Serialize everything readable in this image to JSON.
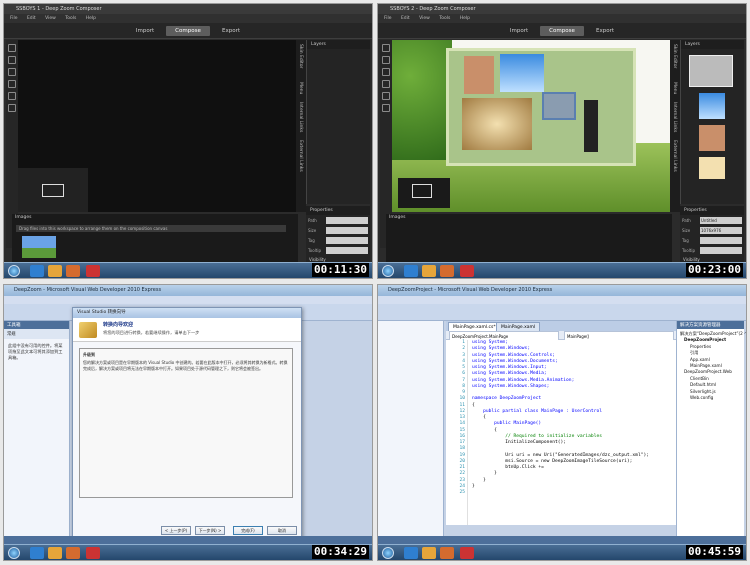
{
  "panels": [
    {
      "title": "SSBOYS 1 - Deep Zoom Composer",
      "menu": [
        "File",
        "Edit",
        "View",
        "Tools",
        "Help"
      ],
      "tabs": [
        "Import",
        "Compose",
        "Export"
      ],
      "active_tab": "Compose",
      "side_tabs": [
        "Skin Editor",
        "Menu",
        "Internal Links",
        "External Links"
      ],
      "layers_title": "Layers",
      "properties_title": "Properties",
      "properties": [
        {
          "label": "Path",
          "value": ""
        },
        {
          "label": "Size",
          "value": ""
        },
        {
          "label": "Tag",
          "value": ""
        },
        {
          "label": "Tooltip",
          "value": ""
        }
      ],
      "visibility_label": "Visibility",
      "images_title": "Images",
      "images_hint": "Drag files into this workspace to arrange them on the composition canvas",
      "timestamp": "00:11:30"
    },
    {
      "title": "SSBOYS 2 - Deep Zoom Composer",
      "menu": [
        "File",
        "Edit",
        "View",
        "Tools",
        "Help"
      ],
      "tabs": [
        "Import",
        "Compose",
        "Export"
      ],
      "active_tab": "Compose",
      "side_tabs": [
        "Skin Editor",
        "Menu",
        "Internal Links",
        "External Links"
      ],
      "layers_title": "Layers",
      "properties_title": "Properties",
      "properties": [
        {
          "label": "Path",
          "value": "Untitled"
        },
        {
          "label": "Size",
          "value": "1076x976"
        },
        {
          "label": "Tag",
          "value": ""
        },
        {
          "label": "Tooltip",
          "value": ""
        }
      ],
      "visibility_label": "Visibility",
      "images_title": "Images",
      "timestamp": "00:23:00"
    },
    {
      "title": "DeepZoom - Microsoft Visual Web Developer 2010 Express",
      "toolbox_title": "工具箱",
      "toolbox_group": "常规",
      "toolbox_text": "此组中没有可用的控件。将某项拖至此文本可将其添加到工具箱。",
      "dialog_title": "Visual Studio 转换向导",
      "dialog_heading": "转换向导欢迎",
      "dialog_sub": "将您的项目进行转换，若要继续操作，请单击下一步",
      "dialog_body_title": "升级到",
      "dialog_body": "您的解决方案或项目是在早期版本的 Visual Studio 中创建的。若要在此版本中打开，必须将其转换为新格式。转换完成后，解决方案或项目将无法在早期版本中打开。如果项目处于源代码管理之下，则它将会被签出。",
      "buttons": [
        "< 上一步(P)",
        "下一步(N) >",
        "完成(F)",
        "取消"
      ],
      "toolbox_tab": "工具箱",
      "timestamp": "00:34:29"
    },
    {
      "title": "DeepZoomProject - Microsoft Visual Web Developer 2010 Express",
      "doc_tabs": [
        "MainPage.xaml.cs*",
        "MainPage.xaml"
      ],
      "nav_left": "DeepZoomProject.MainPage",
      "nav_right": "MainPage()",
      "line_numbers": [
        "1",
        "2",
        "3",
        "4",
        "5",
        "6",
        "7",
        "8",
        "9",
        "10",
        "11",
        "12",
        "13",
        "14",
        "15",
        "16",
        "17",
        "18",
        "19",
        "20",
        "21",
        "22",
        "23",
        "24",
        "25"
      ],
      "code": [
        "using System;",
        "using System.Windows;",
        "using System.Windows.Controls;",
        "using System.Windows.Documents;",
        "using System.Windows.Input;",
        "using System.Windows.Media;",
        "using System.Windows.Media.Animation;",
        "using System.Windows.Shapes;",
        "",
        "namespace DeepZoomProject",
        "{",
        "    public partial class MainPage : UserControl",
        "    {",
        "        public MainPage()",
        "        {",
        "            // Required to initialize variables",
        "            InitializeComponent();",
        "",
        "            Uri uri = new Uri(\"GeneratedImages/dzc_output.xml\");",
        "            msi.Source = new DeepZoomImageTileSource(uri);",
        "            btnUp.Click += ",
        "        }",
        "    }",
        "}",
        ""
      ],
      "tooltip": "new RoutedEventHandler(btnUp_Click);  (按 TAB 键插入)",
      "solution_title": "解决方案资源管理器",
      "tree": [
        "解决方案“DeepZoomProject”(2 个项目)",
        "DeepZoomProject",
        "Properties",
        "引用",
        "App.xaml",
        "MainPage.xaml",
        "DeepZoomProject.Web",
        "ClientBin",
        "Default.html",
        "Silverlight.js",
        "Web.config"
      ],
      "timestamp": "00:45:59"
    }
  ]
}
